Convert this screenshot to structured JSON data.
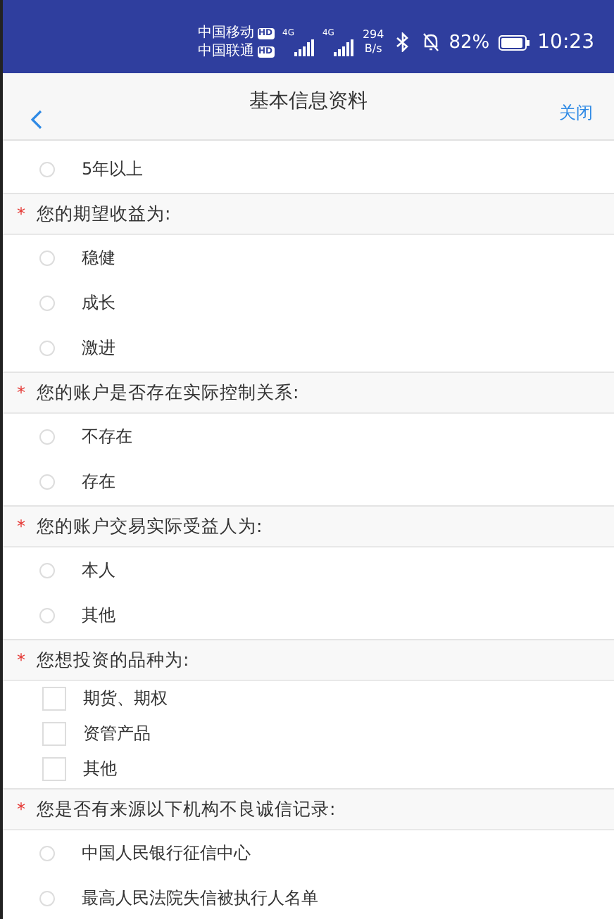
{
  "status_bar": {
    "carriers": [
      {
        "name": "中国移动",
        "badge": "HD"
      },
      {
        "name": "中国联通",
        "badge": "HD"
      }
    ],
    "network": [
      "4G",
      "4G"
    ],
    "speed_value": "294",
    "speed_unit": "B/s",
    "battery_percent": "82%",
    "time": "10:23"
  },
  "header": {
    "title": "基本信息资料",
    "close": "关闭"
  },
  "leading_options": [
    {
      "label": "5年以上",
      "selected": false
    }
  ],
  "sections": [
    {
      "kind": "radio",
      "required_mark": "*",
      "question": "您的期望收益为:",
      "options": [
        {
          "label": "稳健",
          "selected": false
        },
        {
          "label": "成长",
          "selected": false
        },
        {
          "label": "激进",
          "selected": false
        }
      ]
    },
    {
      "kind": "radio",
      "required_mark": "*",
      "question": "您的账户是否存在实际控制关系:",
      "options": [
        {
          "label": "不存在",
          "selected": false
        },
        {
          "label": "存在",
          "selected": false
        }
      ]
    },
    {
      "kind": "radio",
      "required_mark": "*",
      "question": "您的账户交易实际受益人为:",
      "options": [
        {
          "label": "本人",
          "selected": false
        },
        {
          "label": "其他",
          "selected": false
        }
      ]
    },
    {
      "kind": "checkbox",
      "required_mark": "*",
      "question": "您想投资的品种为:",
      "options": [
        {
          "label": "期货、期权",
          "selected": false
        },
        {
          "label": "资管产品",
          "selected": false
        },
        {
          "label": "其他",
          "selected": false
        }
      ]
    },
    {
      "kind": "radio",
      "required_mark": "*",
      "question": "您是否有来源以下机构不良诚信记录:",
      "options": [
        {
          "label": "中国人民银行征信中心",
          "selected": false
        },
        {
          "label": "最高人民法院失信被执行人名单",
          "selected": false
        }
      ]
    }
  ]
}
